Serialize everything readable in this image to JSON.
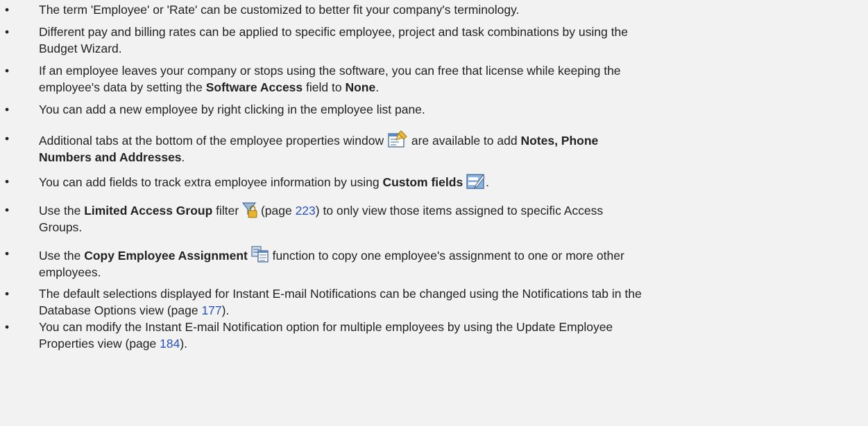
{
  "bullet_char": "•",
  "tips": [
    {
      "text": "The term 'Employee' or 'Rate' can be customized to better fit your company's terminology."
    },
    {
      "line1": "Different pay and billing rates can be applied to specific employee, project and task combinations by using the",
      "line2": "Budget Wizard."
    },
    {
      "line1": "If an employee leaves your company or stops using the software, you can free that license while keeping the",
      "line2_pre": "employee's data by setting the ",
      "bold1": "Software Access",
      "mid": " field to ",
      "bold2": "None",
      "post": "."
    },
    {
      "text": "You can add a new employee by right clicking in the employee list pane."
    },
    {
      "pre": "Additional tabs at the bottom of the employee properties window ",
      "icon": "properties-window-icon",
      "mid": " are available to add ",
      "bold1": "Notes, Phone",
      "bold2": "Numbers and Addresses",
      "post": "."
    },
    {
      "pre": "You can add fields to track extra employee information by using ",
      "bold": "Custom fields",
      "icon": "custom-fields-icon",
      "post": "."
    },
    {
      "pre": "Use the ",
      "bold": "Limited Access Group",
      "mid": " filter ",
      "icon": "limited-access-filter-icon",
      "page_pre": " (page ",
      "page": "223",
      "post": ") to only view those items assigned to specific Access",
      "line2": "Groups."
    },
    {
      "pre": "Use the ",
      "bold": "Copy Employee Assignment",
      "icon": "copy-assignment-icon",
      "post": " function to copy one employee's assignment to one or more other",
      "line2": "employees."
    },
    {
      "line1": "The default selections displayed for Instant E-mail Notifications can be changed using the Notifications tab in the",
      "line2_pre": "Database Options view (page ",
      "page": "177",
      "post": ")."
    },
    {
      "line1": "You can modify the Instant E-mail Notification option for multiple employees by using the Update Employee",
      "line2_pre": "Properties view (page ",
      "page": "184",
      "post": ")."
    }
  ]
}
